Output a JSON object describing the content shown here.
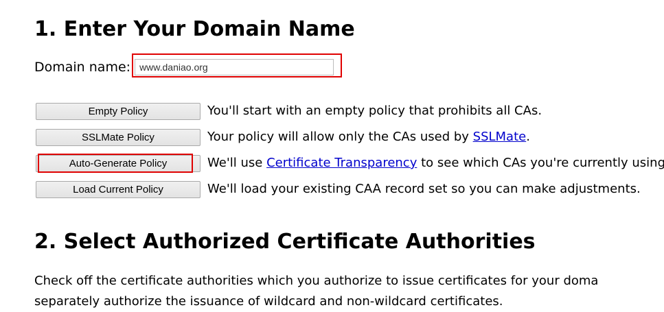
{
  "step1": {
    "heading": "1. Enter Your Domain Name",
    "domain_label": "Domain name:",
    "domain_value": "www.daniao.org"
  },
  "policies": [
    {
      "button_label": "Empty Policy",
      "description_before": "You'll start with an empty policy that prohibits all CAs.",
      "link_text": "",
      "description_after": ""
    },
    {
      "button_label": "SSLMate Policy",
      "description_before": "Your policy will allow only the CAs used by ",
      "link_text": "SSLMate",
      "description_after": "."
    },
    {
      "button_label": "Auto-Generate Policy",
      "description_before": "We'll use ",
      "link_text": "Certificate Transparency",
      "description_after": " to see which CAs you're currently using."
    },
    {
      "button_label": "Load Current Policy",
      "description_before": "We'll load your existing CAA record set so you can make adjustments.",
      "link_text": "",
      "description_after": ""
    }
  ],
  "step2": {
    "heading": "2. Select Authorized Certificate Authorities",
    "line1": "Check off the certificate authorities which you authorize to issue certificates for your doma",
    "line2": "separately authorize the issuance of wildcard and non-wildcard certificates."
  },
  "colors": {
    "highlight": "#e00000",
    "link": "#0000cc"
  }
}
